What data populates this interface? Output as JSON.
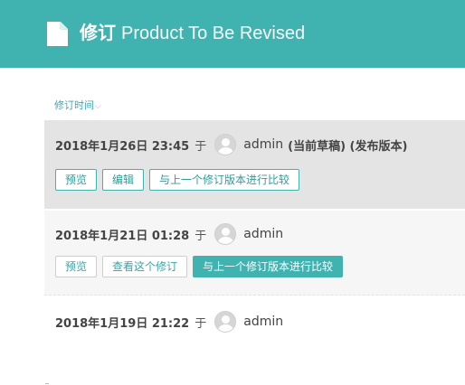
{
  "header": {
    "strong_title": "修订",
    "subtitle": "Product To Be Revised",
    "icon": "document-icon"
  },
  "sort": {
    "label": "修订时间",
    "icon": "chevron-down-icon"
  },
  "revisions": [
    {
      "time": "2018年1月26日 23:45",
      "at": "于",
      "author": "admin",
      "flags": "(当前草稿) (发布版本)",
      "buttons": [
        "预览",
        "编辑",
        "与上一个修订版本进行比较"
      ]
    },
    {
      "time": "2018年1月21日 01:28",
      "at": "于",
      "author": "admin",
      "flags": "",
      "buttons": [
        "预览",
        "查看这个修订",
        "与上一个修订版本进行比较"
      ]
    },
    {
      "time": "2018年1月19日 21:22",
      "at": "于",
      "author": "admin",
      "flags": "",
      "buttons": []
    }
  ],
  "colors": {
    "accent": "#40b3b0",
    "current_row_bg": "#e4e4e4",
    "second_row_bg": "#f6f6f6"
  }
}
